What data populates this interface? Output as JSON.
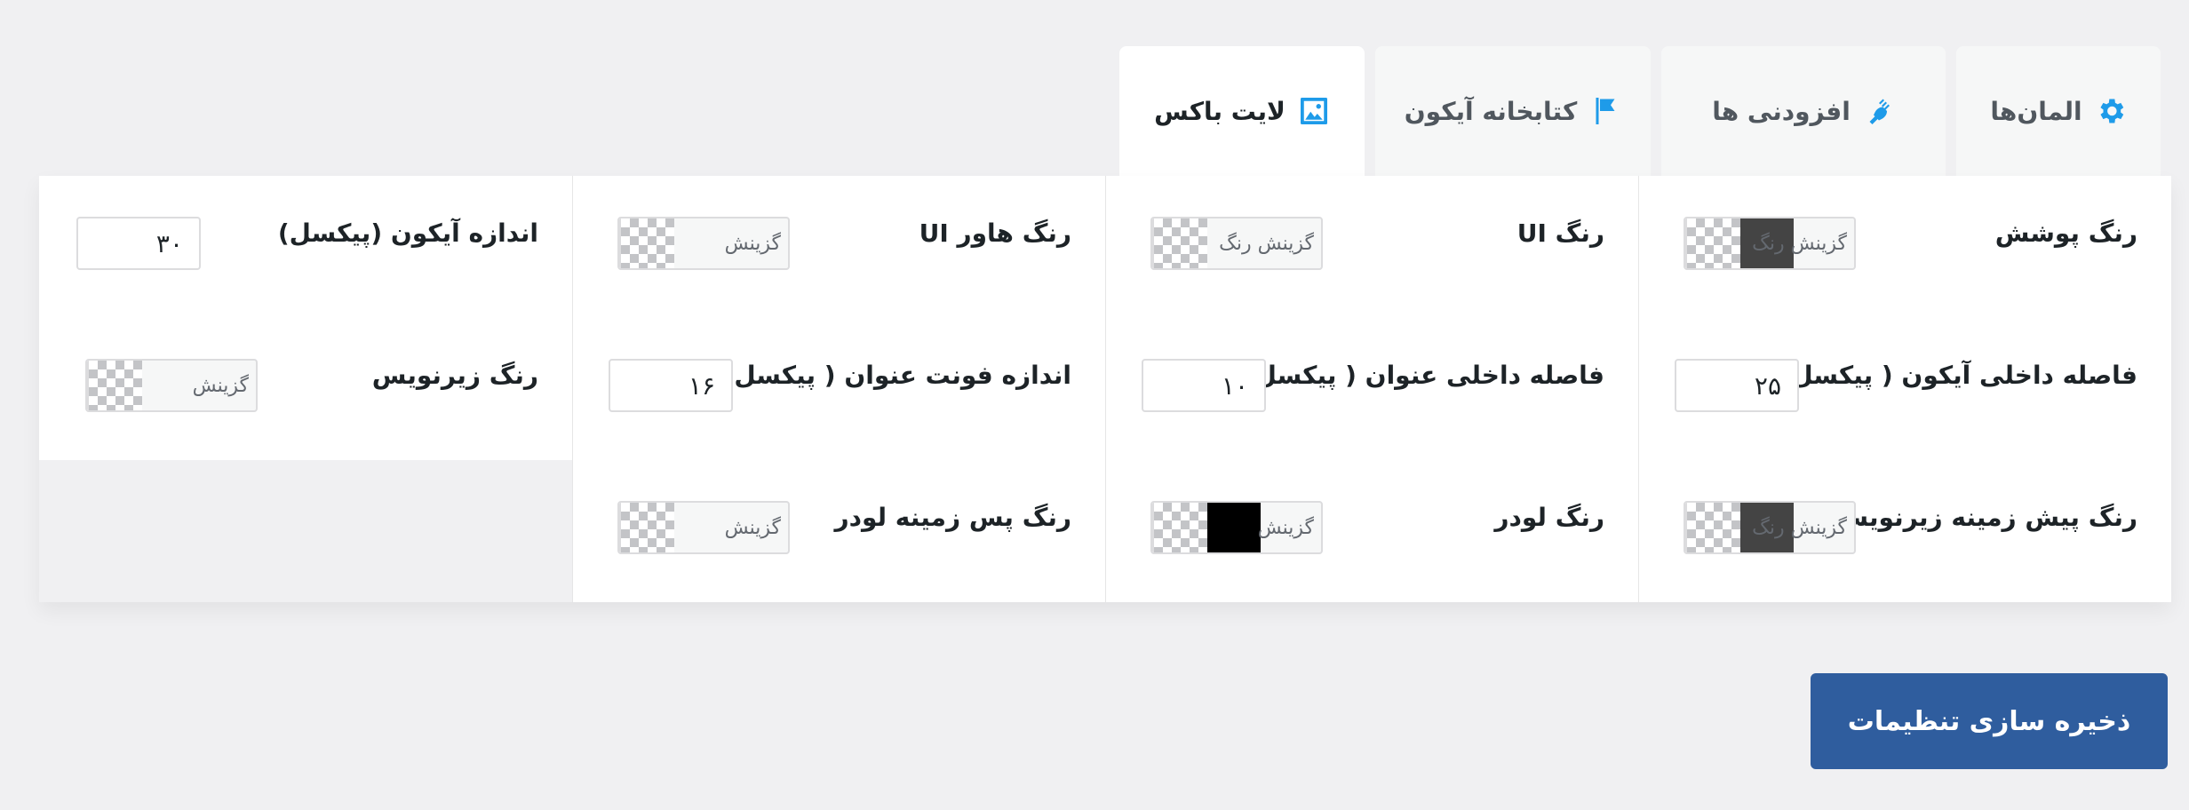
{
  "tabs": [
    {
      "label": "المان‌ها",
      "icon": "gear-icon",
      "icon_color": "#1e9be9",
      "active": false
    },
    {
      "label": "افزودنی ها",
      "icon": "plugin-icon",
      "icon_color": "#1e9be9",
      "active": false
    },
    {
      "label": "کتابخانه آیکون",
      "icon": "flag-icon",
      "icon_color": "#1e9be9",
      "active": false
    },
    {
      "label": "لایت باکس",
      "icon": "image-icon",
      "icon_color": "#1e9be9",
      "active": true
    }
  ],
  "settings": {
    "overlay_color": {
      "label": "رنگ پوشش",
      "picker_text": "گزینش رنگ",
      "color": "#444444"
    },
    "ui_color": {
      "label": "رنگ UI",
      "picker_text": "گزینش رنگ",
      "color": ""
    },
    "ui_hover_color": {
      "label": "رنگ هاور UI",
      "picker_text": "گزینش",
      "color": ""
    },
    "icon_size": {
      "label": "اندازه آیکون (پیکسل)",
      "value": "۳۰"
    },
    "icon_padding": {
      "label": "فاصله داخلی آیکون ( پیکسل)",
      "value": "۲۵"
    },
    "title_padding": {
      "label": "فاصله داخلی عنوان ( پیکسل )",
      "value": "۱۰"
    },
    "title_font_size": {
      "label": "اندازه فونت عنوان ( پیکسل)",
      "value": "۱۶"
    },
    "caption_color": {
      "label": "رنگ زیرنویس",
      "picker_text": "گزینش",
      "color": ""
    },
    "caption_bg_color": {
      "label": "رنگ پیش زمینه زیرنویس",
      "picker_text": "گزینش رنگ",
      "color": "#444444"
    },
    "loader_color": {
      "label": "رنگ لودر",
      "picker_text": "گزینش",
      "color": "#000000"
    },
    "loader_bg_color": {
      "label": "رنگ پس زمینه لودر",
      "picker_text": "گزینش",
      "color": ""
    }
  },
  "save_button": {
    "label": "ذخیره سازی تنظیمات"
  },
  "colors": {
    "accent": "#1e9be9",
    "primary_button": "#2f5d9e"
  }
}
